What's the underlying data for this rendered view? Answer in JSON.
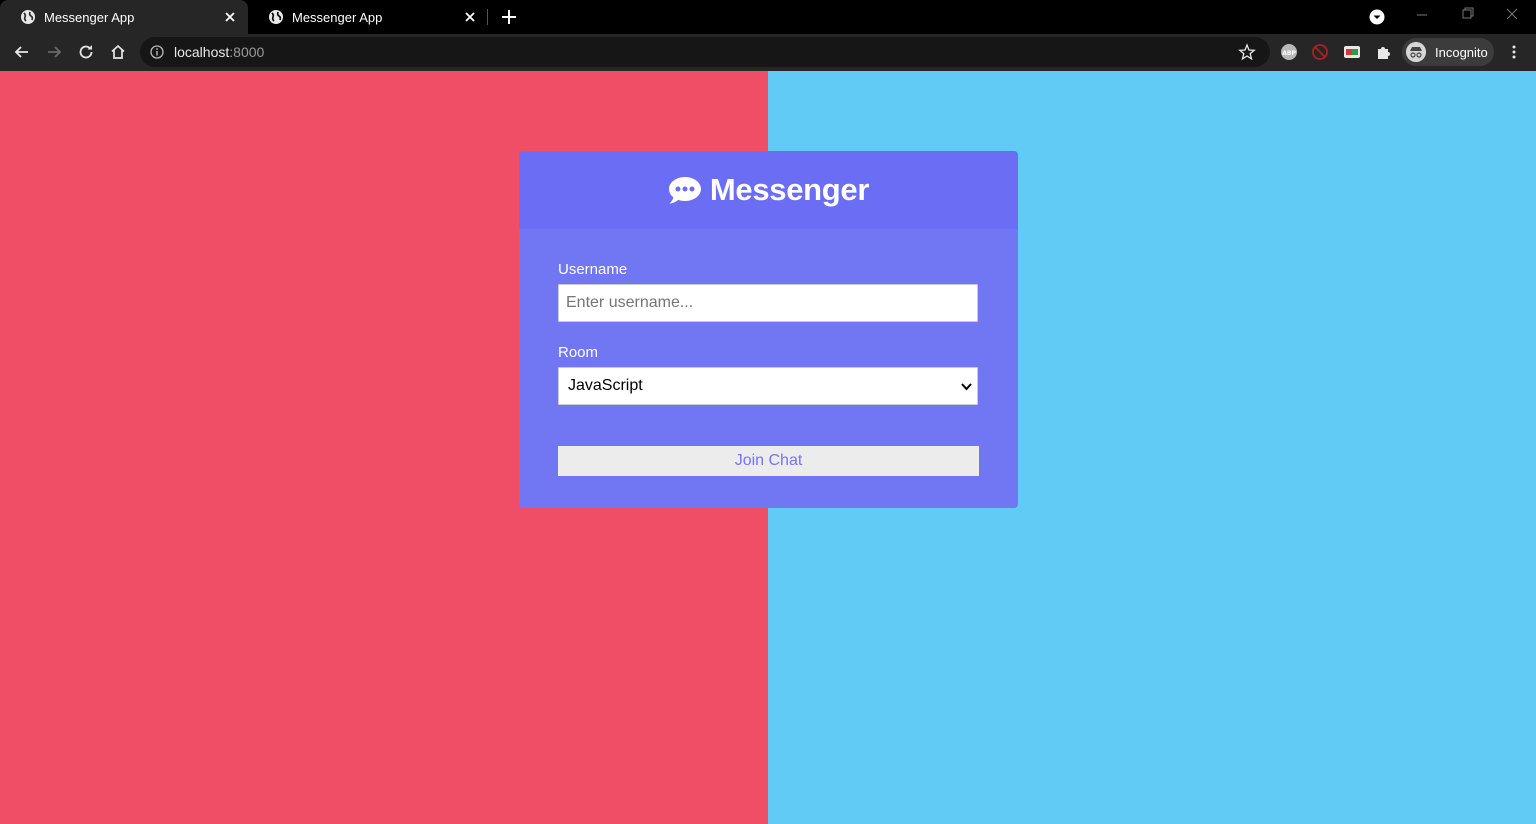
{
  "browser": {
    "tabs": [
      {
        "title": "Messenger App",
        "active": true
      },
      {
        "title": "Messenger App",
        "active": false
      }
    ],
    "address": {
      "host": "localhost",
      "port": ":8000"
    },
    "profile_label": "Incognito"
  },
  "page": {
    "title": "Messenger",
    "logo_icon": "comment-dots-icon",
    "username": {
      "label": "Username",
      "placeholder": "Enter username...",
      "value": ""
    },
    "room": {
      "label": "Room",
      "selected": "JavaScript"
    },
    "join_label": "Join Chat"
  },
  "colors": {
    "left_background": "#f04e66",
    "right_background": "#62cbf5",
    "card": "#7176f3",
    "card_header": "#6b6ef4",
    "button_text": "#7176f3"
  }
}
